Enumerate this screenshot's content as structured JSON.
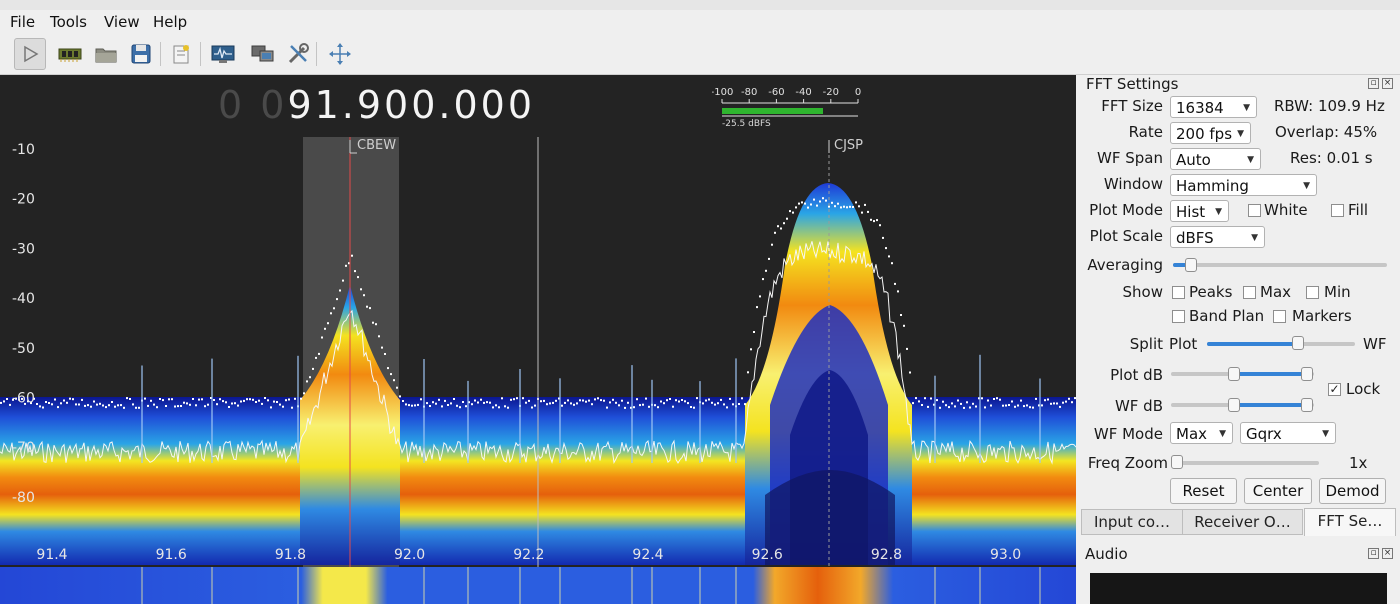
{
  "menu": {
    "file": "File",
    "tools": "Tools",
    "view": "View",
    "help": "Help"
  },
  "toolbar": {
    "icons": [
      "start-icon",
      "hardware-icon",
      "open-icon",
      "save-icon",
      "bookmark-icon",
      "iq-tool-icon",
      "network-icon",
      "configure-icon",
      "fullscreen-icon"
    ]
  },
  "frequency": {
    "dim_digits": "0 0",
    "value": "91.900.000"
  },
  "meter": {
    "ticks": [
      "-100",
      "-80",
      "-60",
      "-40",
      "-20",
      "0"
    ],
    "readout": "-25.5 dBFS",
    "level_fraction": 0.745
  },
  "plot": {
    "y_ticks": [
      "-10",
      "-20",
      "-30",
      "-40",
      "-50",
      "-60",
      "-70",
      "-80"
    ],
    "x_ticks": [
      "91.4",
      "91.6",
      "91.8",
      "92.0",
      "92.2",
      "92.4",
      "92.6",
      "92.8",
      "93.0"
    ],
    "stations": [
      "CBEW",
      "CJSP"
    ]
  },
  "fft": {
    "title": "FFT Settings",
    "fft_size_label": "FFT Size",
    "fft_size": "16384",
    "rbw": "RBW: 109.9 Hz",
    "rate_label": "Rate",
    "rate": "200 fps",
    "overlap": "Overlap: 45%",
    "wf_span_label": "WF Span",
    "wf_span": "Auto",
    "res": "Res: 0.01 s",
    "window_label": "Window",
    "window": "Hamming",
    "plot_mode_label": "Plot Mode",
    "plot_mode": "Hist",
    "white_label": "White",
    "fill_label": "Fill",
    "plot_scale_label": "Plot Scale",
    "plot_scale": "dBFS",
    "averaging_label": "Averaging",
    "show_label": "Show",
    "peaks_label": "Peaks",
    "max_label": "Max",
    "min_label": "Min",
    "band_plan_label": "Band Plan",
    "markers_label": "Markers",
    "split_label": "Split",
    "split_plot": "Plot",
    "split_wf": "WF",
    "plot_db_label": "Plot dB",
    "lock_label": "Lock",
    "wf_db_label": "WF dB",
    "wf_mode_label": "WF Mode",
    "wf_mode": "Max",
    "wf_palette": "Gqrx",
    "freq_zoom_label": "Freq Zoom",
    "freq_zoom": "1x",
    "reset": "Reset",
    "center": "Center",
    "demod": "Demod"
  },
  "tabs": [
    "Input co…",
    "Receiver O…",
    "FFT Se…"
  ],
  "audio": {
    "title": "Audio"
  }
}
